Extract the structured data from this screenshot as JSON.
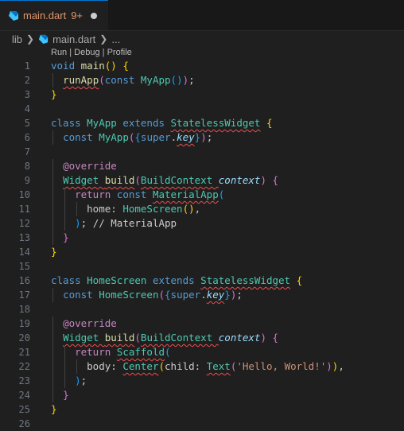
{
  "tab": {
    "filename": "main.dart",
    "problem_count": "9+",
    "icon": "dart-icon",
    "dirty": true
  },
  "breadcrumb": {
    "folder": "lib",
    "file": "main.dart",
    "ellipsis": "..."
  },
  "codelens": {
    "run": "Run",
    "debug": "Debug",
    "profile": "Profile",
    "separator": " | "
  },
  "colors": {
    "tab_warning": "#e2966b",
    "keyword": "#569cd6",
    "function": "#dcdcaa",
    "class": "#4ec9b0",
    "string": "#ce9178",
    "squiggle": "#f14c4c"
  },
  "lines": [
    {
      "n": "1",
      "parts": [
        [
          "void ",
          "kw"
        ],
        [
          "main",
          "fn"
        ],
        [
          "() ",
          "b1"
        ],
        [
          "{",
          "b1"
        ]
      ]
    },
    {
      "n": "2",
      "parts": [
        [
          "  ",
          ""
        ],
        [
          "runApp",
          "fn sq"
        ],
        [
          "(",
          "b2"
        ],
        [
          "const ",
          "kw"
        ],
        [
          "MyApp",
          "cls"
        ],
        [
          "()",
          "b3"
        ],
        [
          ")",
          "b2"
        ],
        [
          ";",
          ""
        ]
      ]
    },
    {
      "n": "3",
      "parts": [
        [
          "}",
          "b1"
        ]
      ]
    },
    {
      "n": "4",
      "parts": []
    },
    {
      "n": "5",
      "parts": [
        [
          "class ",
          "kw"
        ],
        [
          "MyApp ",
          "cls"
        ],
        [
          "extends ",
          "kw"
        ],
        [
          "StatelessWidget",
          "cls sq"
        ],
        [
          " ",
          ""
        ],
        [
          "{",
          "b1"
        ]
      ]
    },
    {
      "n": "6",
      "parts": [
        [
          "  ",
          ""
        ],
        [
          "const ",
          "kw"
        ],
        [
          "MyApp",
          "cls"
        ],
        [
          "(",
          "b2"
        ],
        [
          "{",
          "b3"
        ],
        [
          "super",
          "kw"
        ],
        [
          ".",
          ""
        ],
        [
          "key",
          "var it sq"
        ],
        [
          "}",
          "b3"
        ],
        [
          ")",
          "b2"
        ],
        [
          ";",
          ""
        ]
      ]
    },
    {
      "n": "7",
      "parts": []
    },
    {
      "n": "8",
      "parts": [
        [
          "  ",
          ""
        ],
        [
          "@override",
          "ctl"
        ]
      ]
    },
    {
      "n": "9",
      "parts": [
        [
          "  ",
          ""
        ],
        [
          "Widget ",
          "cls sq"
        ],
        [
          "build",
          "fn sq"
        ],
        [
          "(",
          "b2"
        ],
        [
          "BuildContext ",
          "cls sq"
        ],
        [
          "context",
          "var it"
        ],
        [
          ")",
          "b2"
        ],
        [
          " ",
          ""
        ],
        [
          "{",
          "b2"
        ]
      ]
    },
    {
      "n": "10",
      "parts": [
        [
          "    ",
          ""
        ],
        [
          "return ",
          "ctl"
        ],
        [
          "const ",
          "kw"
        ],
        [
          "MaterialApp",
          "cls sq"
        ],
        [
          "(",
          "b3"
        ]
      ]
    },
    {
      "n": "11",
      "parts": [
        [
          "      ",
          ""
        ],
        [
          "home",
          ""
        ],
        [
          ": ",
          ""
        ],
        [
          "HomeScreen",
          "cls"
        ],
        [
          "()",
          "b1"
        ],
        [
          ",",
          ""
        ]
      ]
    },
    {
      "n": "12",
      "parts": [
        [
          "    ",
          ""
        ],
        [
          ")",
          "b3"
        ],
        [
          "; ",
          ""
        ],
        [
          "// MaterialApp",
          ""
        ]
      ]
    },
    {
      "n": "13",
      "parts": [
        [
          "  ",
          ""
        ],
        [
          "}",
          "b2"
        ]
      ]
    },
    {
      "n": "14",
      "parts": [
        [
          "}",
          "b1"
        ]
      ]
    },
    {
      "n": "15",
      "parts": []
    },
    {
      "n": "16",
      "parts": [
        [
          "class ",
          "kw"
        ],
        [
          "HomeScreen ",
          "cls"
        ],
        [
          "extends ",
          "kw"
        ],
        [
          "StatelessWidget",
          "cls sq"
        ],
        [
          " ",
          ""
        ],
        [
          "{",
          "b1"
        ]
      ]
    },
    {
      "n": "17",
      "parts": [
        [
          "  ",
          ""
        ],
        [
          "const ",
          "kw"
        ],
        [
          "HomeScreen",
          "cls"
        ],
        [
          "(",
          "b2"
        ],
        [
          "{",
          "b3"
        ],
        [
          "super",
          "kw"
        ],
        [
          ".",
          ""
        ],
        [
          "key",
          "var it sq"
        ],
        [
          "}",
          "b3"
        ],
        [
          ")",
          "b2"
        ],
        [
          ";",
          ""
        ]
      ]
    },
    {
      "n": "18",
      "parts": []
    },
    {
      "n": "19",
      "parts": [
        [
          "  ",
          ""
        ],
        [
          "@override",
          "ctl"
        ]
      ]
    },
    {
      "n": "20",
      "parts": [
        [
          "  ",
          ""
        ],
        [
          "Widget ",
          "cls sq"
        ],
        [
          "build",
          "fn sq"
        ],
        [
          "(",
          "b2"
        ],
        [
          "BuildContext ",
          "cls sq"
        ],
        [
          "context",
          "var it"
        ],
        [
          ")",
          "b2"
        ],
        [
          " ",
          ""
        ],
        [
          "{",
          "b2"
        ]
      ]
    },
    {
      "n": "21",
      "parts": [
        [
          "    ",
          ""
        ],
        [
          "return ",
          "ctl"
        ],
        [
          "Scaffold",
          "cls sq"
        ],
        [
          "(",
          "b3"
        ]
      ]
    },
    {
      "n": "22",
      "parts": [
        [
          "      ",
          ""
        ],
        [
          "body",
          ""
        ],
        [
          ": ",
          ""
        ],
        [
          "Center",
          "cls sq"
        ],
        [
          "(",
          "b1"
        ],
        [
          "child",
          ""
        ],
        [
          ": ",
          ""
        ],
        [
          "Text",
          "cls sq"
        ],
        [
          "(",
          "b2"
        ],
        [
          "'Hello, World!'",
          "str"
        ],
        [
          ")",
          "b2"
        ],
        [
          ")",
          "b1"
        ],
        [
          ",",
          ""
        ]
      ]
    },
    {
      "n": "23",
      "parts": [
        [
          "    ",
          ""
        ],
        [
          ")",
          "b3"
        ],
        [
          ";",
          ""
        ]
      ]
    },
    {
      "n": "24",
      "parts": [
        [
          "  ",
          ""
        ],
        [
          "}",
          "b2"
        ]
      ]
    },
    {
      "n": "25",
      "parts": [
        [
          "}",
          "b1"
        ]
      ]
    },
    {
      "n": "26",
      "parts": []
    }
  ]
}
